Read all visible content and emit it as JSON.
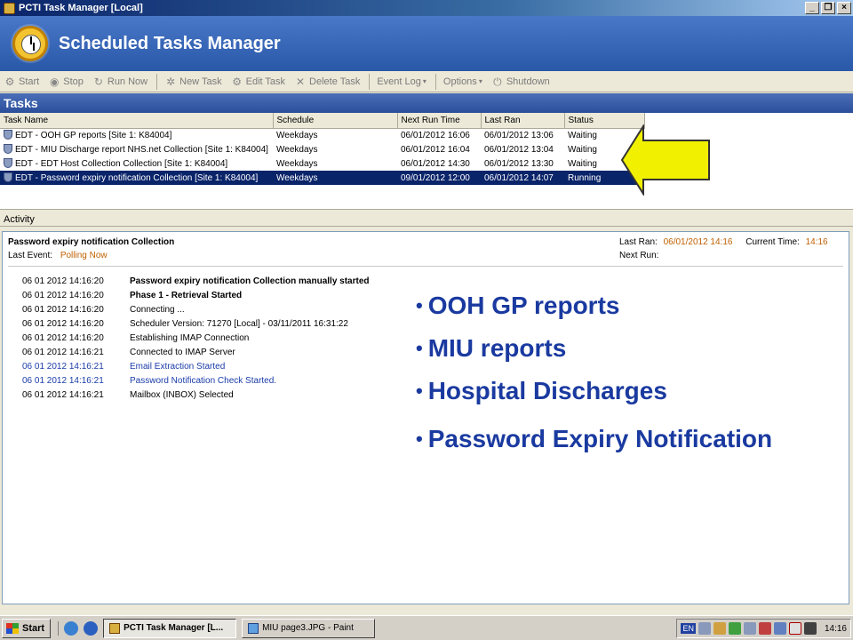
{
  "window": {
    "title": "PCTI Task Manager [Local]",
    "buttons": [
      "_",
      "❐",
      "×"
    ]
  },
  "banner": {
    "title": "Scheduled Tasks Manager"
  },
  "toolbar": {
    "start": "Start",
    "stop": "Stop",
    "run_now": "Run Now",
    "new_task": "New Task",
    "edit_task": "Edit Task",
    "delete_task": "Delete Task",
    "event_log": "Event Log",
    "options": "Options",
    "shutdown": "Shutdown"
  },
  "tasks": {
    "heading": "Tasks",
    "columns": [
      "Task Name",
      "Schedule",
      "Next Run Time",
      "Last Ran",
      "Status"
    ],
    "rows": [
      [
        "EDT - OOH GP reports [Site 1: K84004]",
        "Weekdays",
        "06/01/2012 16:06",
        "06/01/2012 13:06",
        "Waiting"
      ],
      [
        "EDT - MIU Discharge report NHS.net Collection [Site 1: K84004]",
        "Weekdays",
        "06/01/2012 16:04",
        "06/01/2012 13:04",
        "Waiting"
      ],
      [
        "EDT - EDT Host Collection Collection [Site 1: K84004]",
        "Weekdays",
        "06/01/2012 14:30",
        "06/01/2012 13:30",
        "Waiting"
      ],
      [
        "EDT - Password expiry notification Collection [Site 1: K84004]",
        "Weekdays",
        "09/01/2012 12:00",
        "06/01/2012 14:07",
        "Running"
      ]
    ]
  },
  "activity": {
    "heading": "Activity",
    "task_title": "Password expiry notification Collection",
    "last_event_label": "Last Event:",
    "last_event_value": "Polling Now",
    "last_ran_label": "Last Ran:",
    "last_ran_value": "06/01/2012 14:16",
    "current_time_label": "Current Time:",
    "current_time_value": "14:16",
    "next_run_label": "Next Run:",
    "log": [
      {
        "ts": "06 01 2012 14:16:20",
        "msg": "Password expiry notification Collection manually started"
      },
      {
        "ts": "06 01 2012 14:16:20",
        "msg": "Phase 1 - Retrieval Started"
      },
      {
        "ts": "06 01 2012 14:16:20",
        "msg": "Connecting ..."
      },
      {
        "ts": "06 01 2012 14:16:20",
        "msg": "Scheduler Version: 71270 [Local] - 03/11/2011 16:31:22"
      },
      {
        "ts": "06 01 2012 14:16:20",
        "msg": "Establishing IMAP Connection"
      },
      {
        "ts": "06 01 2012 14:16:21",
        "msg": "Connected to IMAP Server"
      },
      {
        "ts": "06 01 2012 14:16:21",
        "msg": "Email Extraction Started"
      },
      {
        "ts": "06 01 2012 14:16:21",
        "msg": "Password Notification Check Started."
      },
      {
        "ts": "06 01 2012 14:16:21",
        "msg": "Mailbox (INBOX) Selected"
      }
    ]
  },
  "overlay_bullets": [
    "OOH GP reports",
    "MIU reports",
    "Hospital Discharges",
    "Password Expiry Notification"
  ],
  "taskbar": {
    "start": "Start",
    "tasks": [
      "PCTI Task Manager [L...",
      "MIU page3.JPG - Paint"
    ],
    "tray_lang": "EN",
    "clock": "14:16"
  },
  "colors": {
    "accent_arrow": "#f0f000",
    "selected_row": "#0a246a",
    "bullet_text": "#1a3aa0",
    "event_value": "#c06000"
  }
}
